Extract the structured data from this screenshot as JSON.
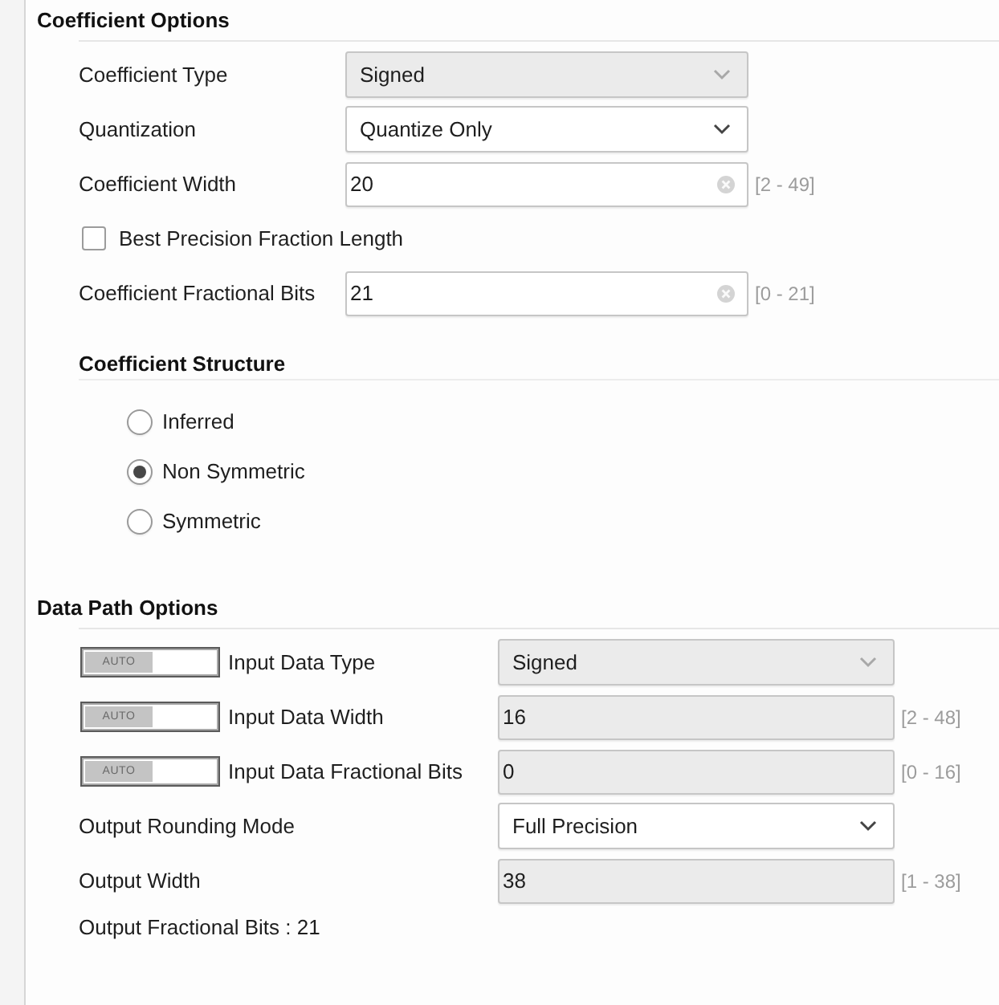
{
  "coefficient_options": {
    "title": "Coefficient Options",
    "fields": [
      {
        "kind": "dropdown",
        "label": "Coefficient Type",
        "value": "Signed",
        "disabled": true
      },
      {
        "kind": "dropdown",
        "label": "Quantization",
        "value": "Quantize Only",
        "disabled": false
      },
      {
        "kind": "number",
        "label": "Coefficient Width",
        "value": "20",
        "range": "[2 - 49]",
        "disabled": false
      },
      {
        "kind": "checkbox",
        "label": "Best Precision Fraction Length",
        "checked": false
      },
      {
        "kind": "number",
        "label": "Coefficient Fractional Bits",
        "value": "21",
        "range": "[0 - 21]",
        "disabled": false
      }
    ],
    "structure": {
      "title": "Coefficient Structure",
      "options": [
        {
          "label": "Inferred",
          "selected": false
        },
        {
          "label": "Non Symmetric",
          "selected": true
        },
        {
          "label": "Symmetric",
          "selected": false
        }
      ]
    }
  },
  "data_path_options": {
    "title": "Data Path Options",
    "fields": [
      {
        "kind": "dropdown",
        "label": "Input Data Type",
        "value": "Signed",
        "disabled": true,
        "toggle": {
          "label": "AUTO",
          "on": true
        }
      },
      {
        "kind": "number",
        "label": "Input Data Width",
        "value": "16",
        "range": "[2 - 48]",
        "disabled": true,
        "toggle": {
          "label": "AUTO",
          "on": true
        }
      },
      {
        "kind": "number",
        "label": "Input Data Fractional Bits",
        "value": "0",
        "range": "[0 - 16]",
        "disabled": true,
        "toggle": {
          "label": "AUTO",
          "on": true
        }
      },
      {
        "kind": "dropdown",
        "label": "Output Rounding Mode",
        "value": "Full Precision",
        "disabled": false
      },
      {
        "kind": "number",
        "label": "Output Width",
        "value": "38",
        "range": "[1 - 38]",
        "disabled": true
      },
      {
        "kind": "text",
        "label": "Output Fractional Bits : 21"
      }
    ]
  }
}
